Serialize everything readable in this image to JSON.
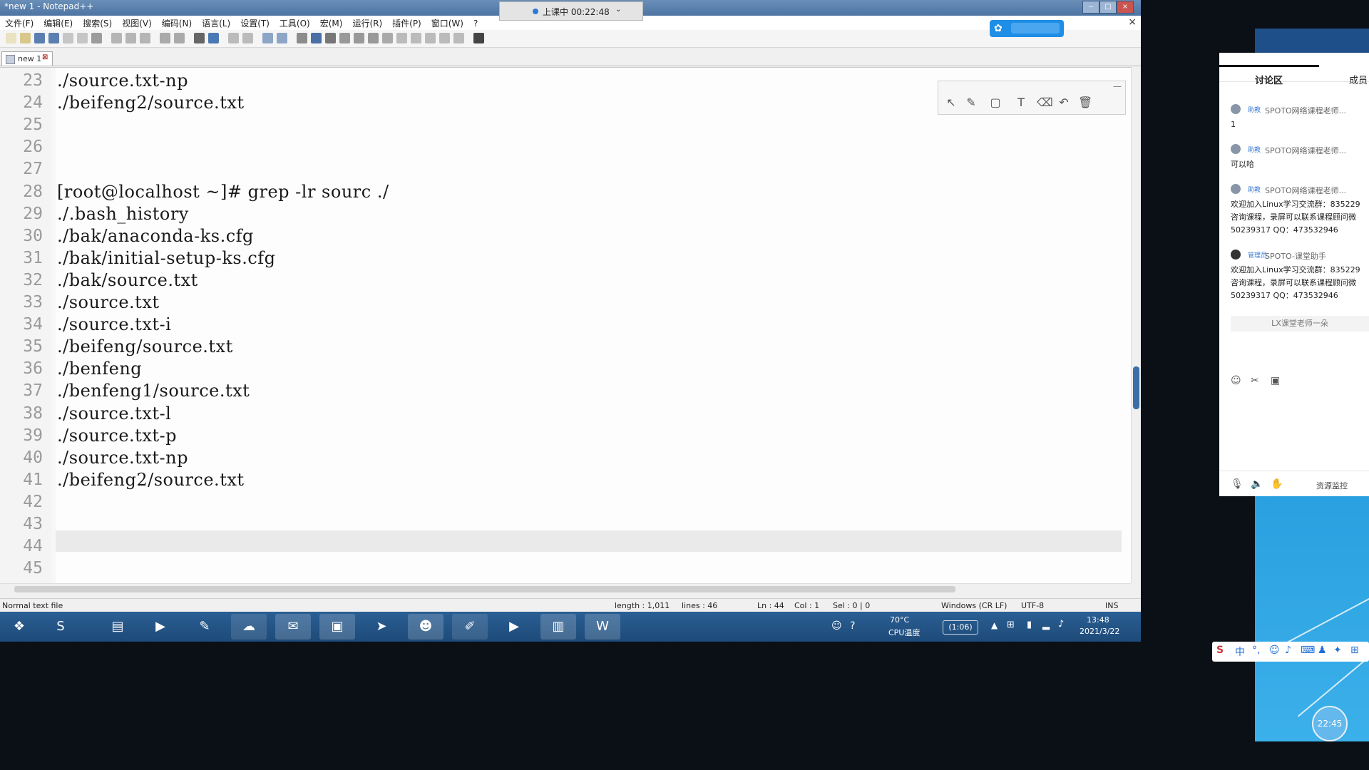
{
  "window": {
    "title": "*new 1 - Notepad++",
    "menu": [
      "文件(F)",
      "编辑(E)",
      "搜索(S)",
      "视图(V)",
      "编码(N)",
      "语言(L)",
      "设置(T)",
      "工具(O)",
      "宏(M)",
      "运行(R)",
      "插件(P)",
      "窗口(W)",
      "?"
    ],
    "close_label": "×",
    "tab_label": "new 1"
  },
  "recording_bar": {
    "status": "上课中 00:22:48"
  },
  "editor": {
    "lines": [
      {
        "num": "23",
        "text": "./source.txt-np"
      },
      {
        "num": "24",
        "text": "./beifeng2/source.txt"
      },
      {
        "num": "25",
        "text": ""
      },
      {
        "num": "26",
        "text": ""
      },
      {
        "num": "27",
        "text": ""
      },
      {
        "num": "28",
        "text": "[root@localhost ~]# grep -lr sourc ./"
      },
      {
        "num": "29",
        "text": "./.bash_history"
      },
      {
        "num": "30",
        "text": "./bak/anaconda-ks.cfg"
      },
      {
        "num": "31",
        "text": "./bak/initial-setup-ks.cfg"
      },
      {
        "num": "32",
        "text": "./bak/source.txt"
      },
      {
        "num": "33",
        "text": "./source.txt"
      },
      {
        "num": "34",
        "text": "./source.txt-i"
      },
      {
        "num": "35",
        "text": "./beifeng/source.txt"
      },
      {
        "num": "36",
        "text": "./benfeng"
      },
      {
        "num": "37",
        "text": "./benfeng1/source.txt"
      },
      {
        "num": "38",
        "text": "./source.txt-l"
      },
      {
        "num": "39",
        "text": "./source.txt-p"
      },
      {
        "num": "40",
        "text": "./source.txt-np"
      },
      {
        "num": "41",
        "text": "./beifeng2/source.txt"
      },
      {
        "num": "42",
        "text": ""
      },
      {
        "num": "43",
        "text": ""
      },
      {
        "num": "44",
        "text": ""
      },
      {
        "num": "45",
        "text": ""
      }
    ]
  },
  "statusbar": {
    "file_type": "Normal text file",
    "length": "length : 1,011",
    "lines": "lines : 46",
    "ln": "Ln : 44",
    "col": "Col : 1",
    "sel": "Sel : 0 | 0",
    "eol": "Windows (CR LF)",
    "encoding": "UTF-8",
    "mode": "INS"
  },
  "taskbar": {
    "cpu_temp": "70°C",
    "cpu_label": "CPU温度",
    "timer": "(1:06)",
    "time": "13:48",
    "date": "2021/3/22"
  },
  "discussion": {
    "tab_discussion": "讨论区",
    "tab_members": "成员",
    "messages": [
      {
        "role": "助教",
        "name": "SPOTO网络课程老师...",
        "body": "1"
      },
      {
        "role": "助教",
        "name": "SPOTO网络课程老师...",
        "body": "可以哈"
      },
      {
        "role": "助教",
        "name": "SPOTO网络课程老师...",
        "body": "欢迎加入Linux学习交流群：835229\n咨询课程，录屏可以联系课程顾问微\n50239317 QQ：473532946"
      },
      {
        "role": "管理员",
        "name": "SPOTO-课堂助手",
        "body": "欢迎加入Linux学习交流群：835229\n咨询课程，录屏可以联系课程顾问微\n50239317 QQ：473532946"
      }
    ],
    "typing": "LX课堂老师一朵",
    "footer_label": "资源监控"
  },
  "overlay": {
    "timer": "22:45"
  },
  "ime": {
    "lang": "中"
  }
}
